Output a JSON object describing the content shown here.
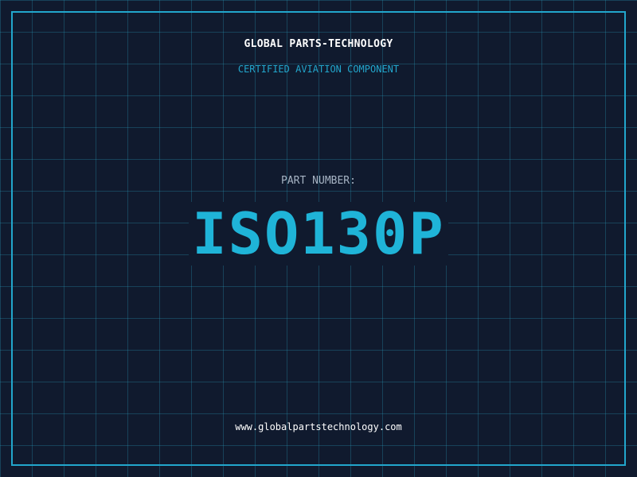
{
  "company": "GLOBAL PARTS-TECHNOLOGY",
  "tagline": "CERTIFIED AVIATION COMPONENT",
  "part": {
    "label": "PART NUMBER:",
    "value": "ISO130P"
  },
  "website": "www.globalpartstechnology.com",
  "colors": {
    "background": "#101a2e",
    "accent": "#1fb4d8",
    "grid": "#1f6f88",
    "text": "#ffffff",
    "muted": "#a7b4c4"
  }
}
